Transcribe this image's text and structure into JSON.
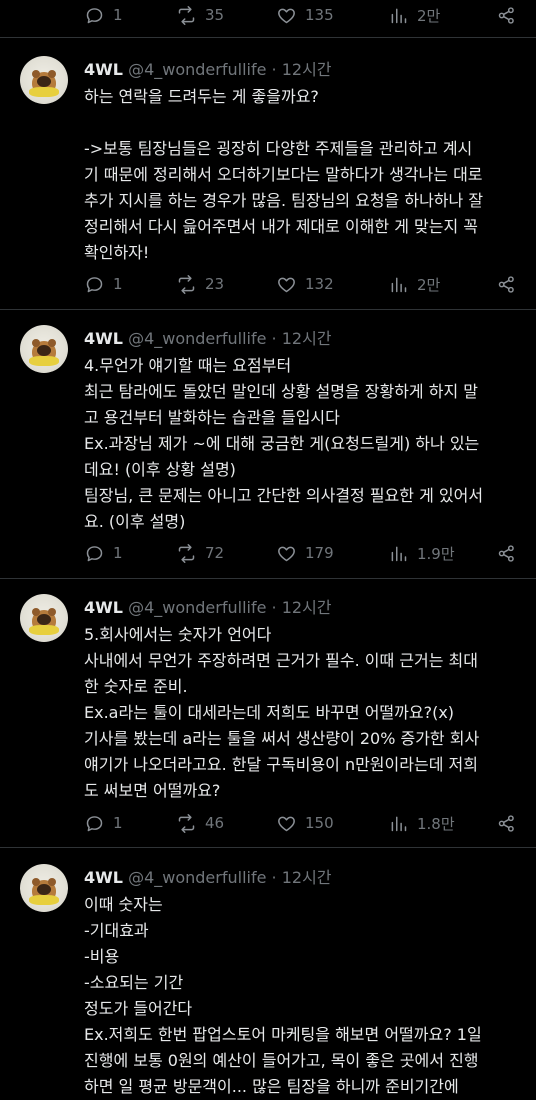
{
  "top_actions": {
    "replies": "1",
    "retweets": "35",
    "likes": "135",
    "views": "2만"
  },
  "author": {
    "name": "4WL",
    "handle": "@4_wonderfullife",
    "time": "12시간"
  },
  "tweets": [
    {
      "text": "하는 연락을 드려두는 게 좋을까요?\n\n->보통 팀장님들은 굉장히 다양한 주제들을 관리하고 계시\n기 때문에 정리해서 오더하기보다는 말하다가 생각나는 대로\n추가 지시를 하는 경우가 많음. 팀장님의 요청을 하나하나 잘\n정리해서 다시 읊어주면서 내가 제대로 이해한 게 맞는지 꼭\n확인하자!",
      "replies": "1",
      "retweets": "23",
      "likes": "132",
      "views": "2만"
    },
    {
      "text": "4.무언가 얘기할 때는 요점부터\n최근 탐라에도 돌았던 말인데 상황 설명을 장황하게 하지 말\n고 용건부터 발화하는 습관을 들입시다\nEx.과장님 제가 ~에 대해 궁금한 게(요청드릴게) 하나 있는\n데요! (이후 상황 설명)\n팀장님, 큰 문제는 아니고 간단한 의사결정 필요한 게 있어서\n요. (이후 설명)",
      "replies": "1",
      "retweets": "72",
      "likes": "179",
      "views": "1.9만"
    },
    {
      "text": "5.회사에서는 숫자가 언어다\n사내에서 무언가 주장하려면 근거가 필수. 이때 근거는 최대\n한 숫자로 준비.\nEx.a라는 툴이 대세라는데 저희도 바꾸면 어떨까요?(x)\n기사를 봤는데 a라는 툴을 써서 생산량이 20% 증가한 회사\n얘기가 나오더라고요. 한달 구독비용이 n만원이라는데 저희\n도 써보면 어떨까요?",
      "replies": "1",
      "retweets": "46",
      "likes": "150",
      "views": "1.8만"
    },
    {
      "text": "이때 숫자는\n-기대효과\n-비용\n-소요되는 기간\n정도가 들어간다\nEx.저희도 한번 팝업스토어 마케팅을 해보면 어떨까요? 1일\n진행에 보통 0원의 예산이 들어가고, 목이 좋은 곳에서 진행\n하면 일 평균 방문객이... 많은 팀장을 하니까 준비기간에"
    }
  ]
}
